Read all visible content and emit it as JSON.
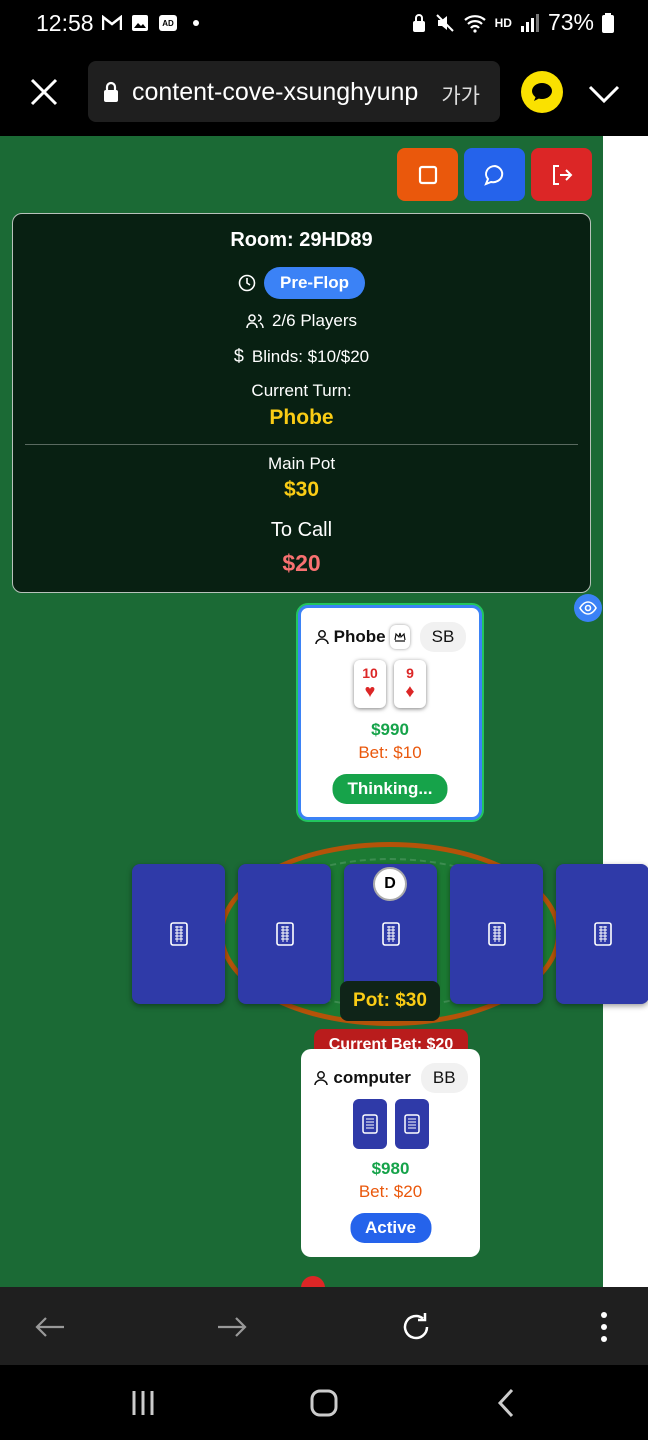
{
  "status_bar": {
    "time": "12:58",
    "battery": "73%",
    "hd_label": "HD"
  },
  "browser": {
    "url": "content-cove-xsunghyunp",
    "text_size_label": "가가"
  },
  "info": {
    "room": "Room: 29HD89",
    "phase": "Pre-Flop",
    "players": "2/6 Players",
    "blinds": "Blinds: $10/$20",
    "turn_label": "Current Turn:",
    "turn_name": "Phobe",
    "pot_label": "Main Pot",
    "pot_value": "$30",
    "call_label": "To Call",
    "call_value": "$20"
  },
  "players": {
    "phobe": {
      "name": "Phobe",
      "position": "SB",
      "cards": [
        {
          "rank": "10",
          "suit": "♥"
        },
        {
          "rank": "9",
          "suit": "♦"
        }
      ],
      "stack": "$990",
      "bet": "Bet: $10",
      "status": "Thinking..."
    },
    "computer": {
      "name": "computer",
      "position": "BB",
      "stack": "$980",
      "bet": "Bet: $20",
      "status": "Active"
    }
  },
  "table": {
    "dealer": "D",
    "pot": "Pot: $30",
    "current_bet": "Current Bet: $20"
  },
  "colors": {
    "felt": "#1b6a35",
    "accent_blue": "#3b82f6",
    "gold": "#facc15",
    "call_red": "#f87171"
  },
  "icons": [
    "close-icon",
    "lock-icon",
    "kakao-chat-icon",
    "chevron-down-icon",
    "stop-icon",
    "chat-icon",
    "logout-icon",
    "clock-icon",
    "users-icon",
    "dollar-icon",
    "user-icon",
    "crown-icon",
    "eye-icon",
    "card-back-icon",
    "back-arrow-icon",
    "forward-arrow-icon",
    "refresh-icon",
    "more-icon"
  ]
}
